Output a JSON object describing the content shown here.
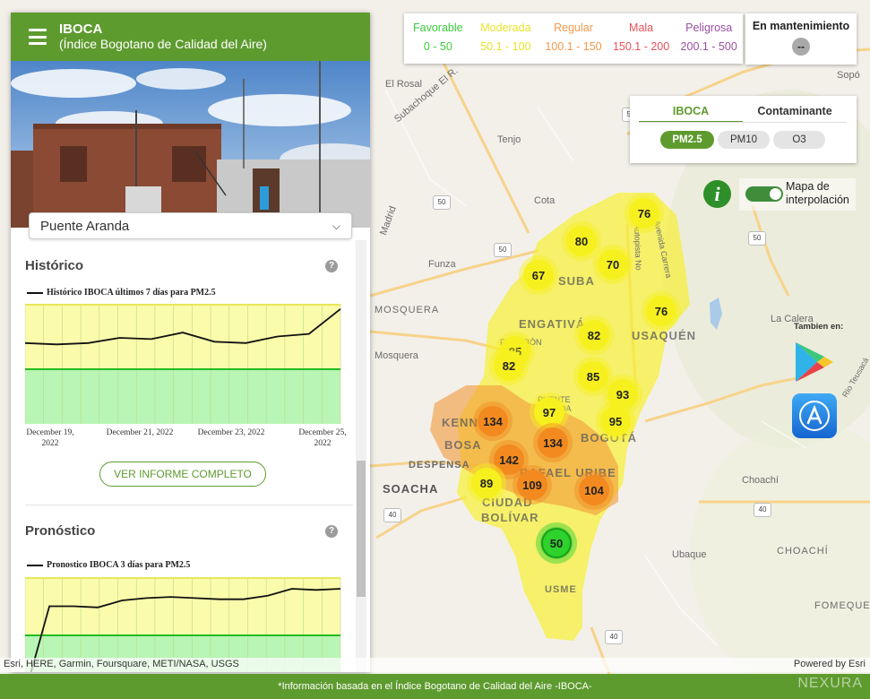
{
  "panel": {
    "title": "IBOCA",
    "subtitle": "(Índice Bogotano de Calidad del Aire)",
    "station": "Puente Aranda",
    "historico": {
      "title": "Histórico",
      "legend": "Histórico IBOCA últimos 7 días para PM2.5",
      "ticks": [
        "December 19, 2022",
        "December 21, 2022",
        "December 23, 2022",
        "December 25, 2022"
      ]
    },
    "ver_informe": "VER INFORME COMPLETO",
    "pronostico": {
      "title": "Pronóstico",
      "legend": "Pronostico IBOCA 3 días para PM2.5"
    }
  },
  "legend": {
    "items": [
      {
        "label": "Favorable",
        "range": "0 - 50",
        "color": "#3ccc3c"
      },
      {
        "label": "Moderada",
        "range": "50.1 - 100",
        "color": "#e8e42a"
      },
      {
        "label": "Regular",
        "range": "100.1 - 150",
        "color": "#f29a4a"
      },
      {
        "label": "Mala",
        "range": "150.1 - 200",
        "color": "#e8505a"
      },
      {
        "label": "Peligrosa",
        "range": "200.1 - 500",
        "color": "#9a4fa2"
      }
    ],
    "maintenance": {
      "label": "En mantenimiento",
      "value": "--"
    }
  },
  "indicator": {
    "tabs": [
      "IBOCA",
      "Contaminante"
    ],
    "active_tab": "IBOCA",
    "pollutants": [
      "PM2.5",
      "PM10",
      "O3"
    ],
    "active_pollutant": "PM2.5"
  },
  "controls": {
    "info": "i",
    "interpolation_label_1": "Mapa de",
    "interpolation_label_2": "interpolación",
    "tambien": "Tambien en:"
  },
  "map": {
    "places": [
      "El Rosal",
      "Subachoque El R.",
      "Tenjo",
      "Cota",
      "Madrid",
      "Funza",
      "MOSQUERA",
      "Mosquera",
      "DESPENSA",
      "La Calera",
      "Sopó",
      "Choachí",
      "Ubaque",
      "CHOACHÍ",
      "FOMEQUE",
      "Rio Teusacá",
      "Avenida Carrera",
      "Autopista No",
      "PUENTE ARANDA",
      "FONTIBÓN",
      "KENNEDY",
      "RAFAEL URIBE"
    ],
    "districts": [
      "SUBA",
      "ENGATIVÁ",
      "USAQUÉN",
      "BOGOTÁ",
      "BOSA",
      "SOACHA",
      "CIUDAD",
      "BOLÍVAR",
      "USME"
    ],
    "roads": [
      "50",
      "50",
      "50",
      "50",
      "40",
      "40",
      "40"
    ],
    "markers": [
      {
        "value": "76",
        "level": "moderada"
      },
      {
        "value": "80",
        "level": "moderada"
      },
      {
        "value": "70",
        "level": "moderada"
      },
      {
        "value": "67",
        "level": "moderada"
      },
      {
        "value": "76",
        "level": "moderada"
      },
      {
        "value": "82",
        "level": "moderada"
      },
      {
        "value": "85",
        "level": "moderada"
      },
      {
        "value": "82",
        "level": "moderada"
      },
      {
        "value": "85",
        "level": "moderada"
      },
      {
        "value": "93",
        "level": "moderada"
      },
      {
        "value": "97",
        "level": "moderada"
      },
      {
        "value": "95",
        "level": "moderada"
      },
      {
        "value": "134",
        "level": "regular"
      },
      {
        "value": "134",
        "level": "regular"
      },
      {
        "value": "142",
        "level": "regular"
      },
      {
        "value": "89",
        "level": "moderada"
      },
      {
        "value": "109",
        "level": "regular"
      },
      {
        "value": "104",
        "level": "regular"
      },
      {
        "value": "50",
        "level": "favorable"
      }
    ]
  },
  "attribution": {
    "left": "Esri, HERE, Garmin, Foursquare, METI/NASA, USGS",
    "right": "Powered by Esri"
  },
  "footer": {
    "text": "*Información basada en el Índice Bogotano de Calidad del Aire -IBOCA-",
    "brand": "NEXURA"
  },
  "chart_data": [
    {
      "type": "line",
      "title": "Histórico IBOCA últimos 7 días para PM2.5",
      "x": [
        "December 19, 2022",
        "December 21, 2022",
        "December 23, 2022",
        "December 25, 2022"
      ],
      "series": [
        {
          "name": "Histórico IBOCA últimos 7 días para PM2.5",
          "values": [
            70,
            69,
            70,
            74,
            73,
            78,
            71,
            70,
            75,
            77,
            96
          ]
        }
      ],
      "grid": true,
      "ylim": [
        0,
        100
      ]
    },
    {
      "type": "line",
      "title": "Pronostico IBOCA 3 días para PM2.5",
      "series": [
        {
          "name": "Pronostico IBOCA 3 días para PM2.5",
          "values": [
            0,
            75,
            75,
            74,
            80,
            82,
            83,
            82,
            81,
            81,
            84,
            90,
            89,
            90
          ]
        }
      ],
      "grid": true,
      "ylim": [
        0,
        100
      ]
    }
  ]
}
